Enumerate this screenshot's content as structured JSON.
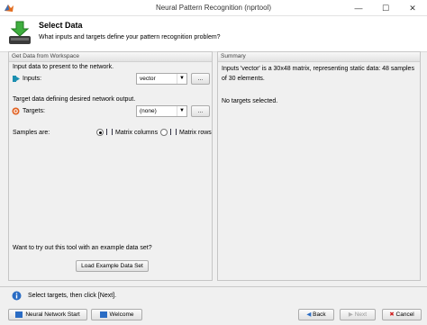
{
  "window": {
    "title": "Neural Pattern Recognition (nprtool)",
    "minimize_glyph": "—",
    "maximize_glyph": "☐",
    "close_glyph": "✕"
  },
  "header": {
    "title": "Select Data",
    "subtitle": "What inputs and targets define your pattern recognition problem?",
    "icon": "data-import-icon"
  },
  "left_panel": {
    "title": "Get Data from Workspace",
    "inputs_section_label": "Input data to present to the network.",
    "inputs_label": "Inputs:",
    "inputs_value": "vector",
    "browse_label": "...",
    "targets_section_label": "Target data defining desired network output.",
    "targets_label": "Targets:",
    "targets_value": "(none)",
    "samples_label": "Samples are:",
    "matrix_columns_label": "Matrix columns",
    "matrix_rows_label": "Matrix rows",
    "selected_sample_orientation": "Matrix columns",
    "example_prompt": "Want to try out this tool with an example data set?",
    "example_button": "Load Example Data Set"
  },
  "summary_panel": {
    "title": "Summary",
    "inputs_summary": "Inputs 'vector' is a 30x48 matrix, representing static data: 48 samples of 30 elements.",
    "targets_summary": "No targets selected."
  },
  "status": {
    "message": "Select targets, then click [Next]."
  },
  "footer": {
    "nn_start_label": "Neural Network Start",
    "welcome_label": "Welcome",
    "back_label": "Back",
    "next_label": "Next",
    "cancel_label": "Cancel"
  },
  "colors": {
    "accent_blue": "#2a6cc4",
    "target_orange": "#e06020",
    "input_teal": "#1b8fb0",
    "cancel_red": "#d02020"
  }
}
